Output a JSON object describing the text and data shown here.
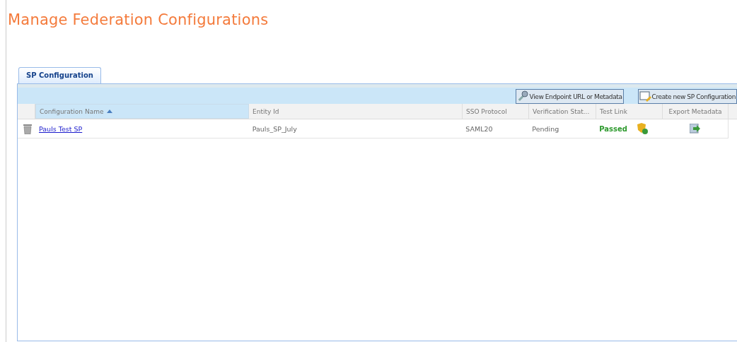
{
  "page_title": "Manage Federation Configurations",
  "tabs": [
    {
      "label": "SP Configuration",
      "selected": true
    }
  ],
  "toolbar": {
    "buttons": [
      "View Endpoint URL or Metadata",
      "Create new SP Configuration"
    ]
  },
  "table": {
    "columns": [
      {
        "label": "Configuration Name",
        "sorted": true
      },
      {
        "label": "Entity Id",
        "sorted": false
      },
      {
        "label": "SSO Protocol",
        "sorted": false
      },
      {
        "label": "Verification Stat...",
        "sorted": false
      },
      {
        "label": "Test Link",
        "sorted": false
      },
      {
        "label": "Export Metadata",
        "sorted": false
      }
    ],
    "rows": [
      {
        "name": "Pauls Test SP",
        "entity_id": "Pauls_SP_July",
        "protocol": "SAML20",
        "verification": "Pending",
        "test_result": "Passed"
      }
    ]
  }
}
